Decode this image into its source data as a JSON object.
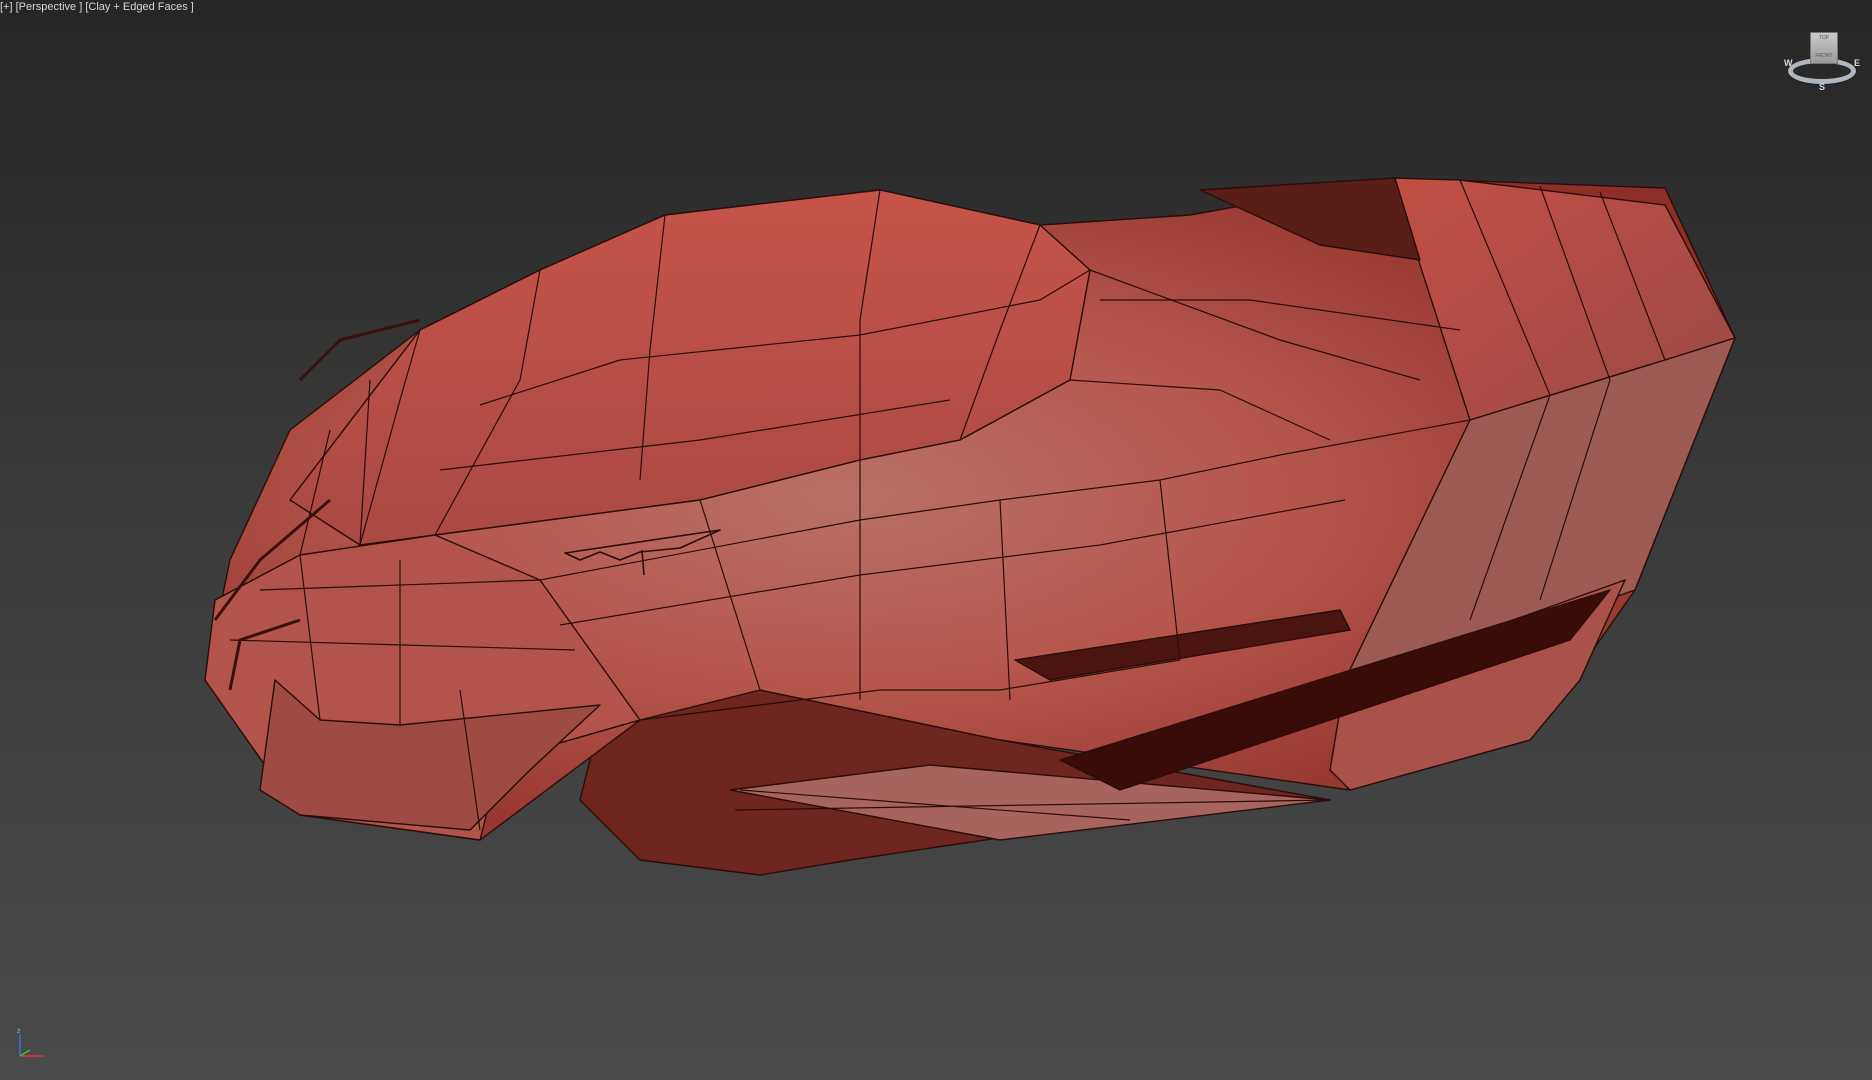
{
  "viewport": {
    "label": {
      "menu": "[+]",
      "view": "[Perspective ]",
      "shading": "[Clay + Edged Faces ]"
    },
    "background_colors": [
      "#262626",
      "#4a4a4a"
    ],
    "model_color": "#b84a40"
  },
  "viewcube": {
    "top_label": "TOP",
    "front_label": "FRONT",
    "compass": {
      "west": "W",
      "east": "E",
      "south": "S"
    }
  },
  "axis_tripod": {
    "z_label": "z"
  },
  "icons": [
    "viewcube-icon",
    "axis-tripod-icon"
  ]
}
